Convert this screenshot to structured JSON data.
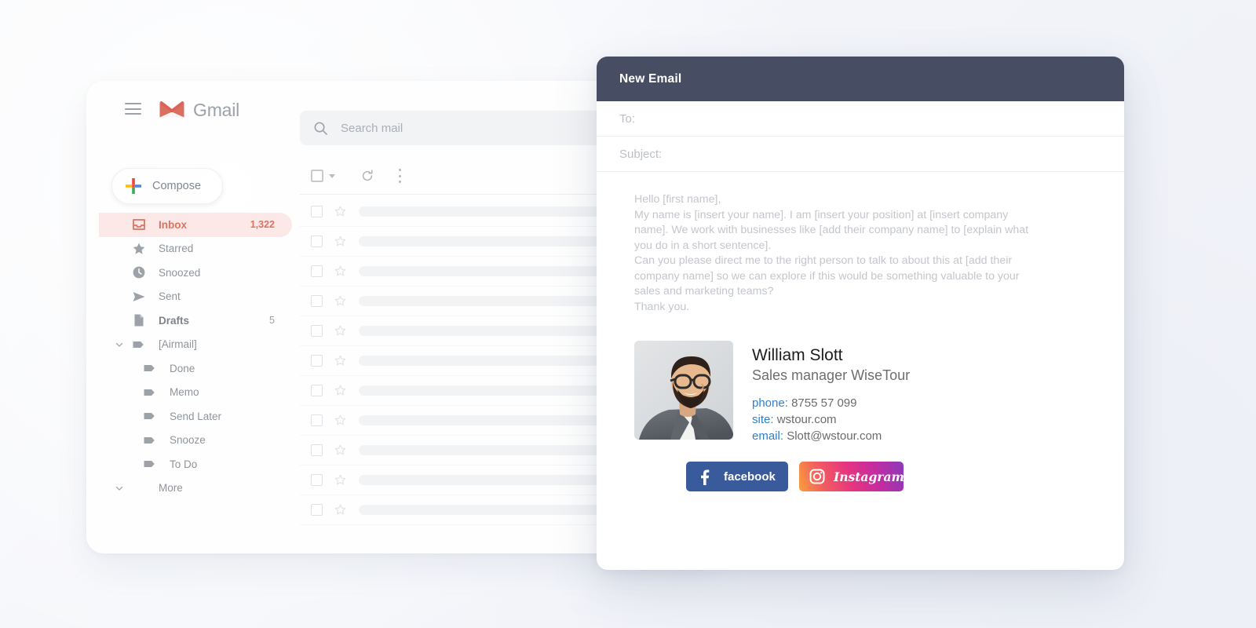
{
  "page": {
    "background_color": "#f4f6fa"
  },
  "gmail": {
    "brand": "Gmail",
    "menu_icon": "hamburger-icon",
    "logo_icon": "gmail-logo-icon",
    "search": {
      "placeholder": "Search mail",
      "icon": "search-icon"
    },
    "compose": {
      "label": "Compose",
      "icon": "plus-icon"
    },
    "nav": [
      {
        "label": "Inbox",
        "count": "1,322",
        "icon": "inbox-icon",
        "active": true,
        "bold": false,
        "nested": false,
        "caret": ""
      },
      {
        "label": "Starred",
        "count": "",
        "icon": "star-icon",
        "active": false,
        "bold": false,
        "nested": false,
        "caret": ""
      },
      {
        "label": "Snoozed",
        "count": "",
        "icon": "clock-icon",
        "active": false,
        "bold": false,
        "nested": false,
        "caret": ""
      },
      {
        "label": "Sent",
        "count": "",
        "icon": "send-icon",
        "active": false,
        "bold": false,
        "nested": false,
        "caret": ""
      },
      {
        "label": "Drafts",
        "count": "5",
        "icon": "draft-icon",
        "active": false,
        "bold": true,
        "nested": false,
        "caret": ""
      },
      {
        "label": "[Airmail]",
        "count": "",
        "icon": "label-icon",
        "active": false,
        "bold": false,
        "nested": false,
        "caret": "chevron-down-icon"
      },
      {
        "label": "Done",
        "count": "",
        "icon": "label-icon",
        "active": false,
        "bold": false,
        "nested": true,
        "caret": ""
      },
      {
        "label": "Memo",
        "count": "",
        "icon": "label-icon",
        "active": false,
        "bold": false,
        "nested": true,
        "caret": ""
      },
      {
        "label": "Send Later",
        "count": "",
        "icon": "label-icon",
        "active": false,
        "bold": false,
        "nested": true,
        "caret": ""
      },
      {
        "label": "Snooze",
        "count": "",
        "icon": "label-icon",
        "active": false,
        "bold": false,
        "nested": true,
        "caret": ""
      },
      {
        "label": "To Do",
        "count": "",
        "icon": "label-icon",
        "active": false,
        "bold": false,
        "nested": true,
        "caret": ""
      },
      {
        "label": "More",
        "count": "",
        "icon": "",
        "active": false,
        "bold": false,
        "nested": false,
        "caret": "chevron-down-icon"
      }
    ],
    "toolbar": {
      "select_all_icon": "checkbox-icon",
      "select_caret_icon": "chevron-down-icon",
      "refresh_icon": "refresh-icon",
      "more_icon": "more-vertical-icon"
    },
    "mail_rows_count": 11,
    "accent_colors": {
      "inbox_pill_bg": "#fce9e7",
      "inbox_text": "#d8705f",
      "logo_red": "#d44638"
    }
  },
  "compose": {
    "title": "New Email",
    "header_color": "#474e63",
    "to_label": "To:",
    "subject_label": "Subject:",
    "body": "Hello [first name],\nMy name is [insert your name]. I am [insert your position] at [insert company name]. We work with businesses like [add their company name] to [explain what you do in a short sentence].\nCan you please direct me to the right person to talk to about this at [add their company name] so we can explore if this would be something valuable to your sales and marketing teams?\nThank you.",
    "signature": {
      "avatar_alt": "portrait-photo-of-bearded-man-with-glasses-in-grey-suit",
      "name": "William Slott",
      "role": "Sales manager WiseTour",
      "contacts": [
        {
          "label": "phone:",
          "value": "8755 57 099"
        },
        {
          "label": "site:",
          "value": "wstour.com"
        },
        {
          "label": "email:",
          "value": "Slott@wstour.com"
        }
      ],
      "label_color": "#2f7fce",
      "social": [
        {
          "name": "facebook",
          "label": "facebook",
          "icon": "facebook-icon",
          "color": "#3a5b9b"
        },
        {
          "name": "instagram",
          "label": "Instagram",
          "icon": "instagram-icon",
          "color": "#e6357f"
        }
      ]
    }
  }
}
